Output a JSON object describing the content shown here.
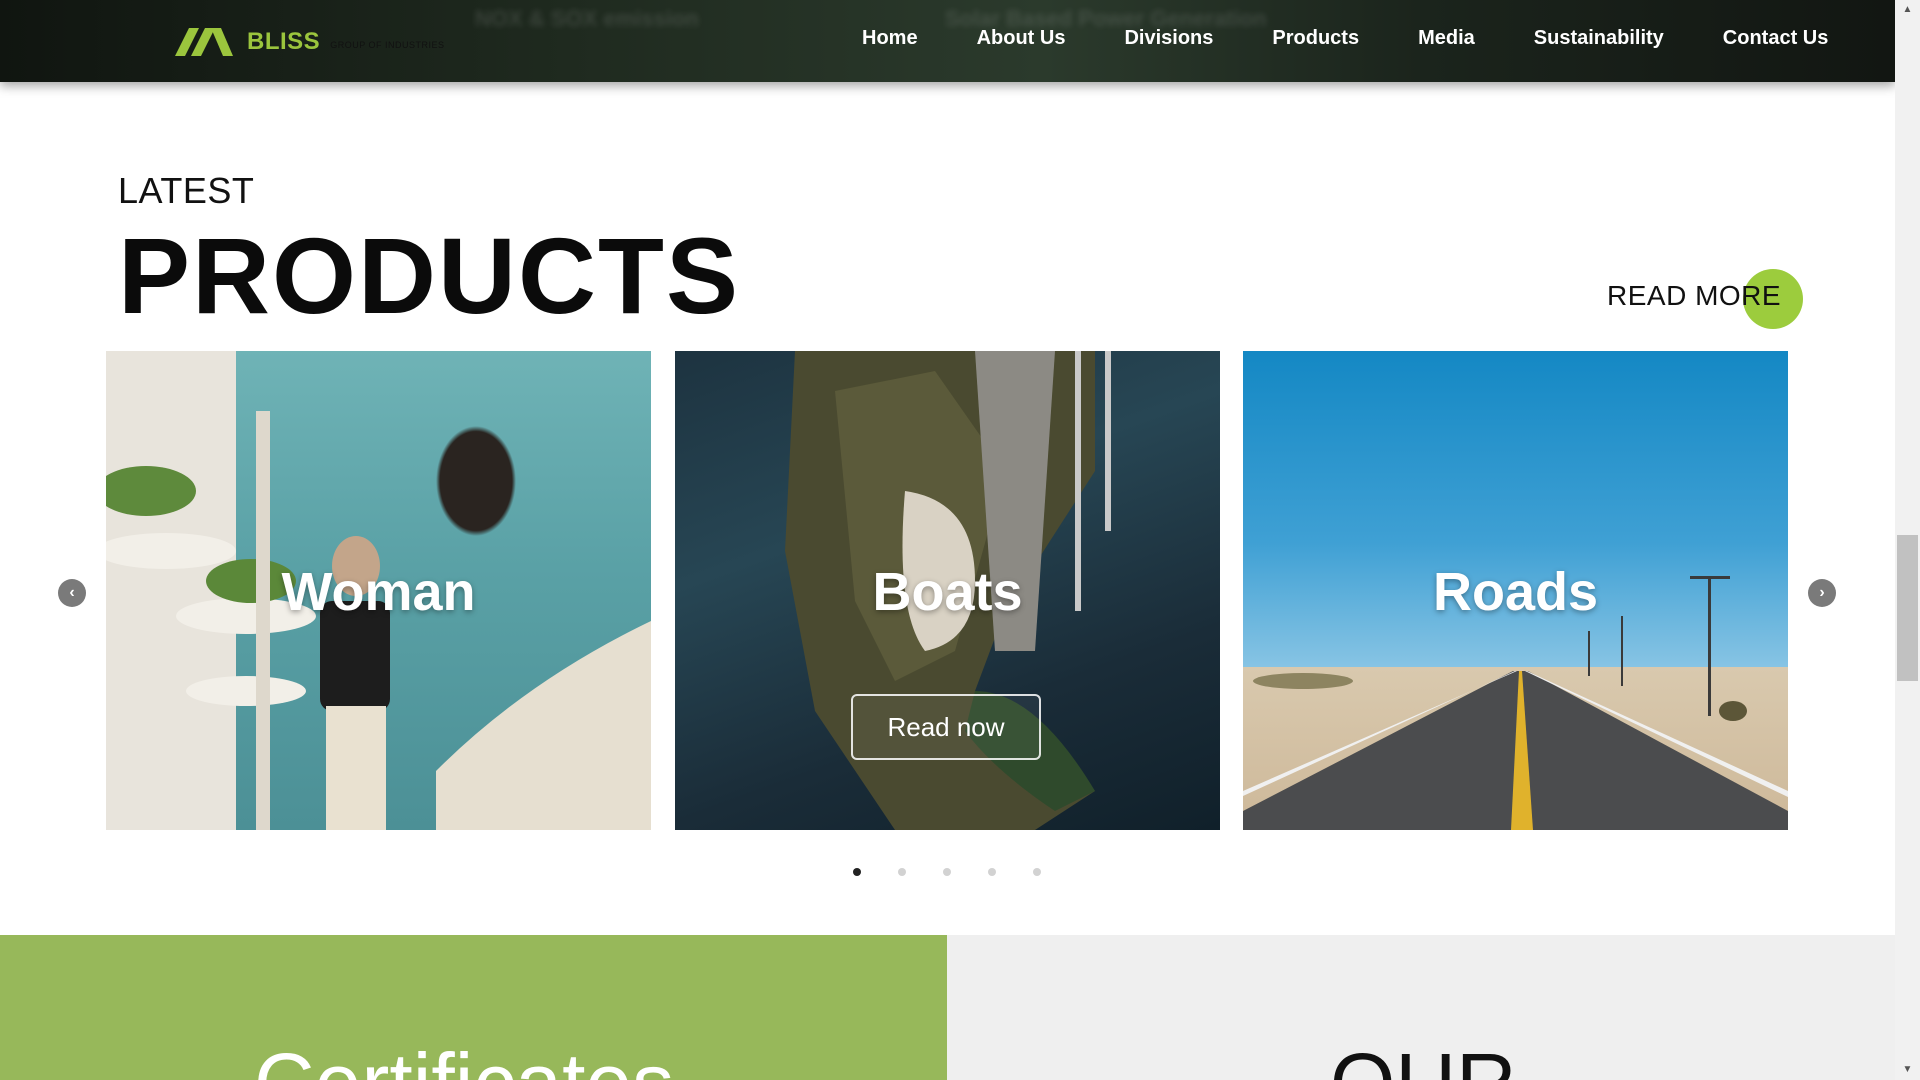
{
  "header": {
    "logo_text": "BLISS",
    "logo_subtext": "GROUP OF INDUSTRIES",
    "background_faded_texts": [
      "NOX & SOX emission",
      "Solar Based Power Generation"
    ],
    "nav": [
      "Home",
      "About Us",
      "Divisions",
      "Products",
      "Media",
      "Sustainability",
      "Contact Us"
    ]
  },
  "products": {
    "eyebrow": "LATEST",
    "title": "PRODUCTS",
    "read_more": "READ MORE",
    "cards": [
      {
        "title": "Woman"
      },
      {
        "title": "Boats",
        "button": "Read now"
      },
      {
        "title": "Roads"
      }
    ],
    "prev_arrow": "‹",
    "next_arrow": "›",
    "slide_count": 5,
    "active_slide": 1
  },
  "bottom": {
    "certificates_text": "Certificates",
    "our_text": "OUR"
  },
  "scrollbar": {
    "up": "▲",
    "down": "▼"
  },
  "colors": {
    "accent_green": "#9ccc3d",
    "certificates_bg": "#97b85a",
    "logo_green": "#9bc53d"
  }
}
